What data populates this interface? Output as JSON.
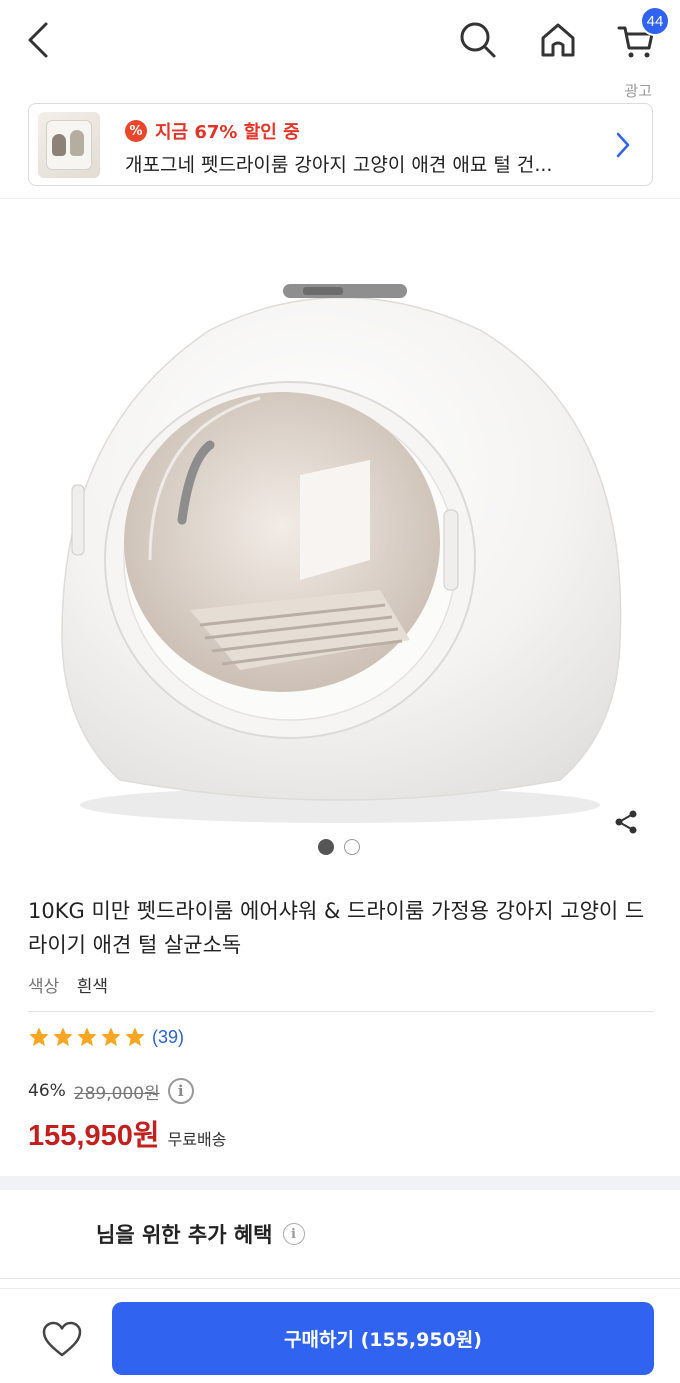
{
  "header": {
    "cart_count": "44",
    "ad_label": "광고"
  },
  "ad_banner": {
    "sale_icon": "%",
    "sale_text": "지금 67% 할인 중",
    "title": "개포그네 펫드라이룸 강아지 고양이 애견 애묘 털 건..."
  },
  "gallery": {
    "total_images": 2,
    "active_index": 0
  },
  "product": {
    "title": "10KG 미만 펫드라이룸 에어샤워 & 드라이룸 가정용 강아지 고양이 드라이기 애견 털 살균소독",
    "option_label": "색상",
    "option_value": "흰색",
    "rating": 5,
    "review_count": "(39)",
    "discount_rate": "46%",
    "original_price": "289,000원",
    "sale_price": "155,950원",
    "shipping": "무료배송"
  },
  "benefit": {
    "text": "님을 위한 추가 혜택"
  },
  "bottom_bar": {
    "buy_label": "구매하기 (155,950원)"
  },
  "colors": {
    "accent": "#2f63f0",
    "sale": "#c21f1f",
    "star": "#f6a623"
  }
}
